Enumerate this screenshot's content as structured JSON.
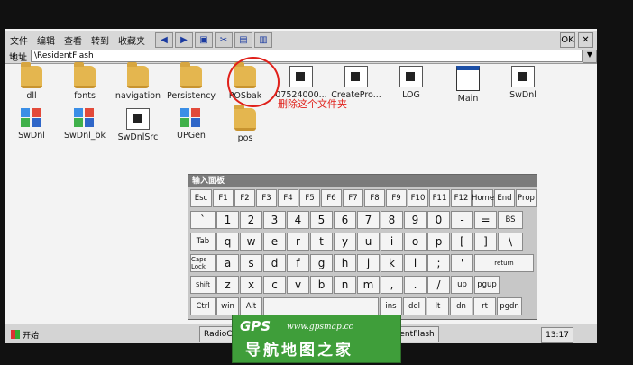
{
  "menubar": {
    "items": [
      "文件",
      "编辑",
      "查看",
      "转到",
      "收藏夹"
    ]
  },
  "address": {
    "label": "地址",
    "value": "\\ResidentFlash"
  },
  "files": [
    {
      "name": "dll",
      "type": "folder"
    },
    {
      "name": "fonts",
      "type": "folder"
    },
    {
      "name": "navigation",
      "type": "folder"
    },
    {
      "name": "Persistency",
      "type": "folder"
    },
    {
      "name": "POSbak",
      "type": "folder"
    },
    {
      "name": "07524000...",
      "type": "exe"
    },
    {
      "name": "CreatePro...",
      "type": "exe"
    },
    {
      "name": "LOG",
      "type": "exe"
    },
    {
      "name": "Main",
      "type": "window"
    },
    {
      "name": "SwDnl",
      "type": "exe"
    },
    {
      "name": "SwDnl",
      "type": "blocks"
    },
    {
      "name": "SwDnl_bk",
      "type": "blocks"
    },
    {
      "name": "SwDnlSrc",
      "type": "exe"
    },
    {
      "name": "UPGen",
      "type": "blocks"
    },
    {
      "name": "pos",
      "type": "folder"
    }
  ],
  "annotation": "删除这个文件夹",
  "keyboard": {
    "title": "输入面板",
    "rows": [
      [
        "Esc",
        "F1",
        "F2",
        "F3",
        "F4",
        "F5",
        "F6",
        "F7",
        "F8",
        "F9",
        "F10",
        "F11",
        "F12",
        "Home",
        "End",
        "Prop"
      ],
      [
        "`",
        "1",
        "2",
        "3",
        "4",
        "5",
        "6",
        "7",
        "8",
        "9",
        "0",
        "-",
        "=",
        "BS"
      ],
      [
        "Tab",
        "q",
        "w",
        "e",
        "r",
        "t",
        "y",
        "u",
        "i",
        "o",
        "p",
        "[",
        "]",
        "\\"
      ],
      [
        "Caps Lock",
        "a",
        "s",
        "d",
        "f",
        "g",
        "h",
        "j",
        "k",
        "l",
        ";",
        "'",
        "return"
      ],
      [
        "Shift",
        "z",
        "x",
        "c",
        "v",
        "b",
        "n",
        "m",
        ",",
        ".",
        "/",
        "up",
        "pgup"
      ],
      [
        "Ctrl",
        "win",
        "Alt",
        "",
        "ins",
        "del",
        "lt",
        "dn",
        "rt",
        "pgdn"
      ]
    ]
  },
  "taskbar": {
    "start": "开始",
    "task1": "RadioCo",
    "task2": "ResidentFlash",
    "time": "13:17"
  },
  "watermark": {
    "brand": "GPS",
    "url": "www.gpsmap.cc",
    "cn": "导航地图之家"
  }
}
